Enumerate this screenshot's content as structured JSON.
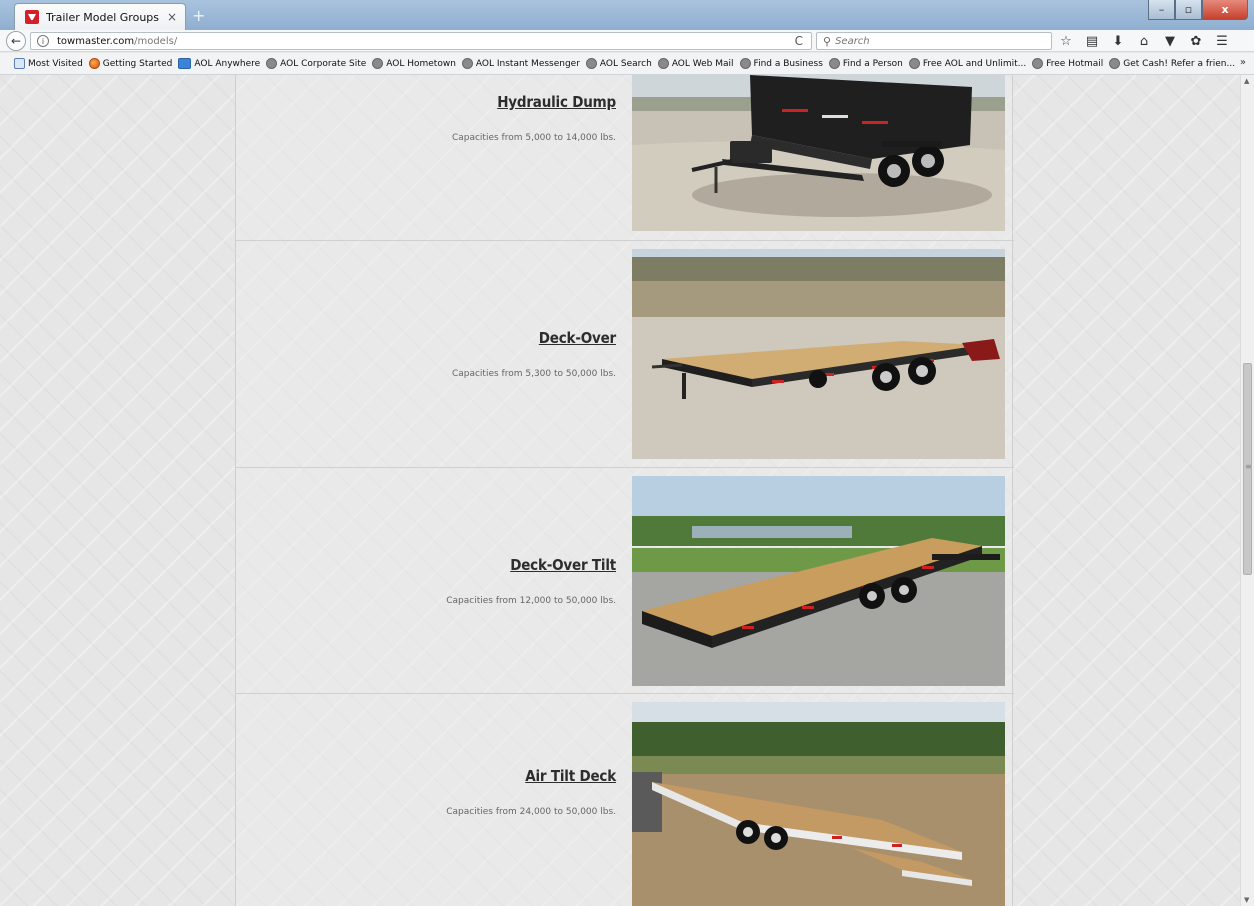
{
  "browser": {
    "tab_title": "Trailer Model Groups",
    "tab_close": "×",
    "new_tab": "+",
    "url_host": "towmaster.com",
    "url_path": "/models/",
    "search_placeholder": "Search",
    "window_min": "–",
    "window_max": "▫",
    "window_close": "x",
    "reload": "C",
    "bookmarks_overflow": "»",
    "bookmarks": [
      {
        "label": "Most Visited",
        "icon": "most-visited-icon"
      },
      {
        "label": "Getting Started",
        "icon": "firefox-icon"
      },
      {
        "label": "AOL Anywhere",
        "icon": "aol-icon"
      },
      {
        "label": "AOL Corporate Site",
        "icon": "globe-icon"
      },
      {
        "label": "AOL Hometown",
        "icon": "globe-icon"
      },
      {
        "label": "AOL Instant Messenger",
        "icon": "globe-icon"
      },
      {
        "label": "AOL Search",
        "icon": "globe-icon"
      },
      {
        "label": "AOL Web Mail",
        "icon": "globe-icon"
      },
      {
        "label": "Find a Business",
        "icon": "globe-icon"
      },
      {
        "label": "Find a Person",
        "icon": "globe-icon"
      },
      {
        "label": "Free AOL and Unlimit...",
        "icon": "globe-icon"
      },
      {
        "label": "Free Hotmail",
        "icon": "globe-icon"
      },
      {
        "label": "Get Cash! Refer a frien...",
        "icon": "globe-icon"
      }
    ]
  },
  "models": [
    {
      "name": "Hydraulic Dump",
      "capacity": "Capacities from 5,000 to 14,000 lbs."
    },
    {
      "name": "Deck-Over",
      "capacity": "Capacities from 5,300 to 50,000 lbs."
    },
    {
      "name": "Deck-Over Tilt",
      "capacity": "Capacities from 12,000 to 50,000 lbs."
    },
    {
      "name": "Air Tilt Deck",
      "capacity": "Capacities from 24,000 to 50,000 lbs."
    }
  ],
  "colors": {
    "accent_red": "#d3202a",
    "trailer_black": "#1d1d1d",
    "deck_wood": "#c99d5e",
    "trailer_white": "#e8e8e8"
  }
}
